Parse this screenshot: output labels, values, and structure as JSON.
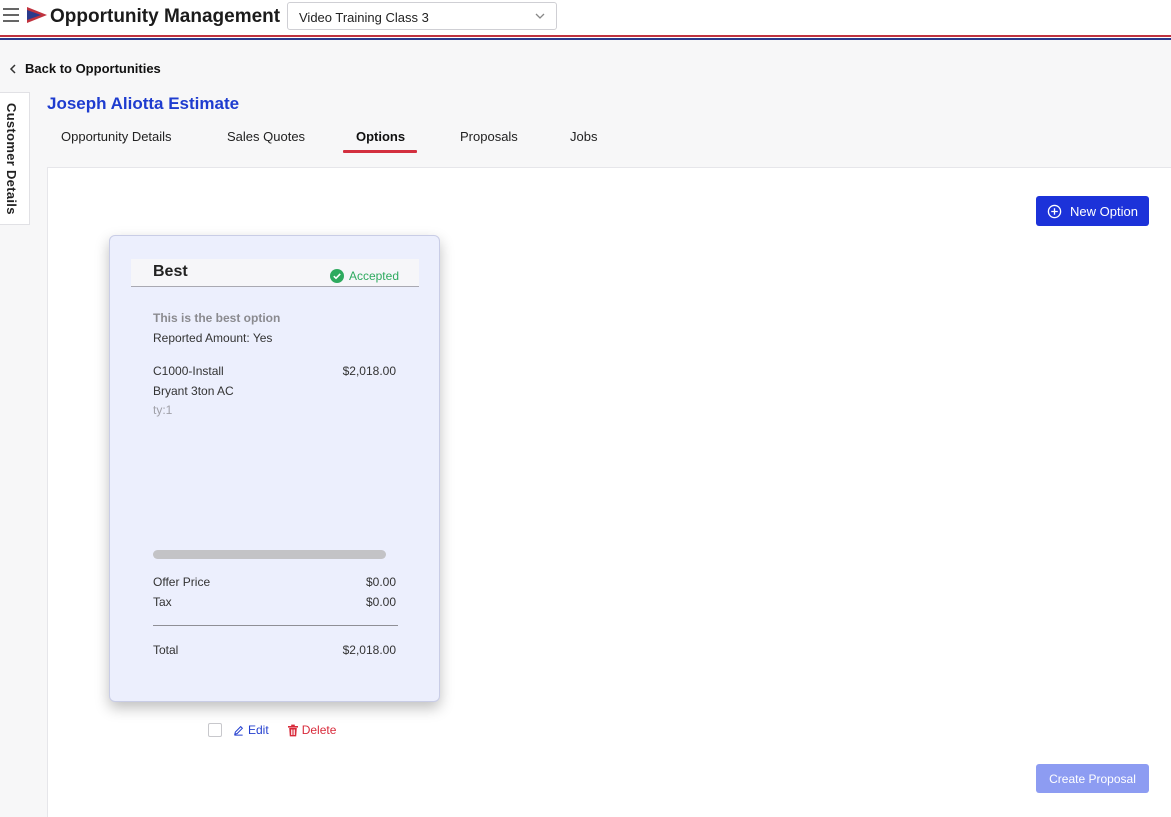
{
  "header": {
    "app_title": "Opportunity Management",
    "class_selector": {
      "value": "Video Training Class 3"
    },
    "brand_colors": {
      "red": "#c0323e",
      "navy": "#2a3a8c"
    }
  },
  "nav": {
    "back_label": "Back to Opportunities"
  },
  "side_tab": {
    "label": "Customer Details"
  },
  "estimate": {
    "title": "Joseph Aliotta Estimate"
  },
  "tabs": [
    {
      "label": "Opportunity Details",
      "active": false
    },
    {
      "label": "Sales Quotes",
      "active": false
    },
    {
      "label": "Options",
      "active": true
    },
    {
      "label": "Proposals",
      "active": false
    },
    {
      "label": "Jobs",
      "active": false
    }
  ],
  "toolbar": {
    "new_option_label": "New Option"
  },
  "option_card": {
    "name": "Best",
    "status": "Accepted",
    "description": "This is the best option",
    "reported_amount": "Reported Amount: Yes",
    "line_item": {
      "code": "C1000-Install",
      "amount": "$2,018.00",
      "description": "Bryant 3ton AC",
      "qty": "ty:1"
    },
    "offer_price_label": "Offer Price",
    "offer_price": "$0.00",
    "tax_label": "Tax",
    "tax": "$0.00",
    "total_label": "Total",
    "total": "$2,018.00"
  },
  "card_actions": {
    "edit_label": "Edit",
    "delete_label": "Delete"
  },
  "footer": {
    "create_proposal_label": "Create Proposal"
  },
  "colors": {
    "accent": "#1c32d9",
    "accepted": "#2eaa5f",
    "danger": "#d82a3a",
    "tab_underline": "#d32f3f"
  }
}
